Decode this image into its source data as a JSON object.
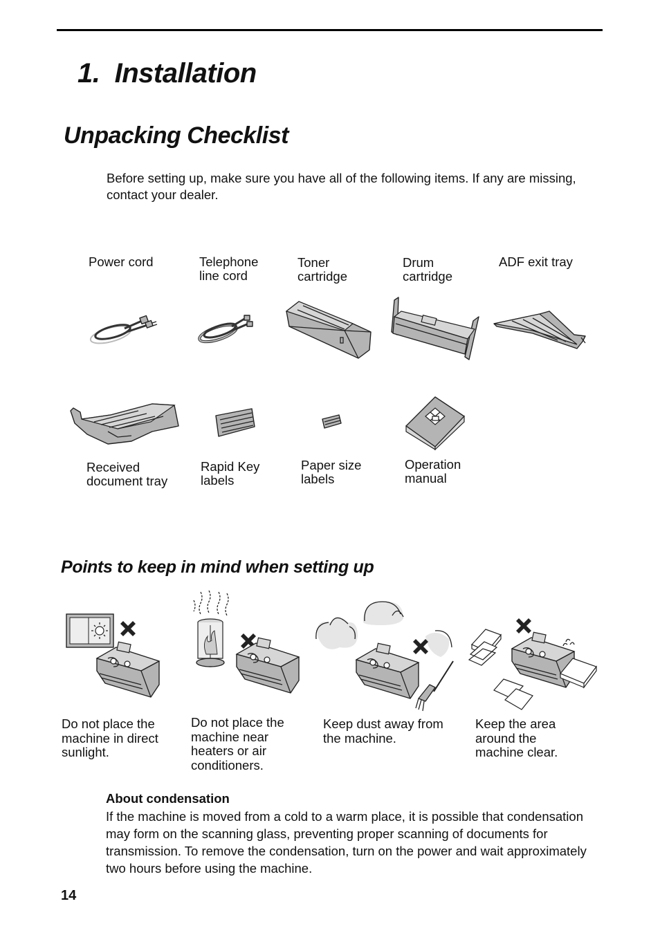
{
  "chapter": {
    "title": "1.  Installation"
  },
  "section": {
    "title": "Unpacking Checklist",
    "intro": "Before setting up, make sure you have all of the following items. If any are missing, contact your dealer."
  },
  "items": [
    {
      "label": "Power cord",
      "icon": "power-cord-icon"
    },
    {
      "label": "Telephone\nline cord",
      "icon": "telephone-line-cord-icon"
    },
    {
      "label": "Toner\ncartridge",
      "icon": "toner-cartridge-icon"
    },
    {
      "label": "Drum\ncartridge",
      "icon": "drum-cartridge-icon"
    },
    {
      "label": "ADF exit tray",
      "icon": "adf-exit-tray-icon"
    },
    {
      "label": "Received\ndocument tray",
      "icon": "received-document-tray-icon"
    },
    {
      "label": "Rapid Key\nlabels",
      "icon": "rapid-key-labels-icon"
    },
    {
      "label": "Paper size\nlabels",
      "icon": "paper-size-labels-icon"
    },
    {
      "label": "Operation\nmanual",
      "icon": "operation-manual-icon"
    }
  ],
  "points": {
    "title": "Points to keep in mind when setting up",
    "tips": [
      {
        "text": "Do not place the\nmachine in direct\nsunlight.",
        "icon": "sunlight-warning-icon"
      },
      {
        "text": "Do not place the\nmachine near\nheaters or air\nconditioners.",
        "icon": "heater-warning-icon"
      },
      {
        "text": "Keep dust away from\nthe machine.",
        "icon": "dust-warning-icon"
      },
      {
        "text": "Keep the area\naround the\nmachine clear.",
        "icon": "clutter-warning-icon"
      }
    ]
  },
  "note": {
    "title": "About condensation",
    "body": "If the machine is moved from a cold to a warm place, it is possible that condensation may form on the scanning glass, preventing proper scanning of documents for transmission. To remove the condensation, turn on the power and wait approximately two hours before using the machine."
  },
  "page_number": "14"
}
